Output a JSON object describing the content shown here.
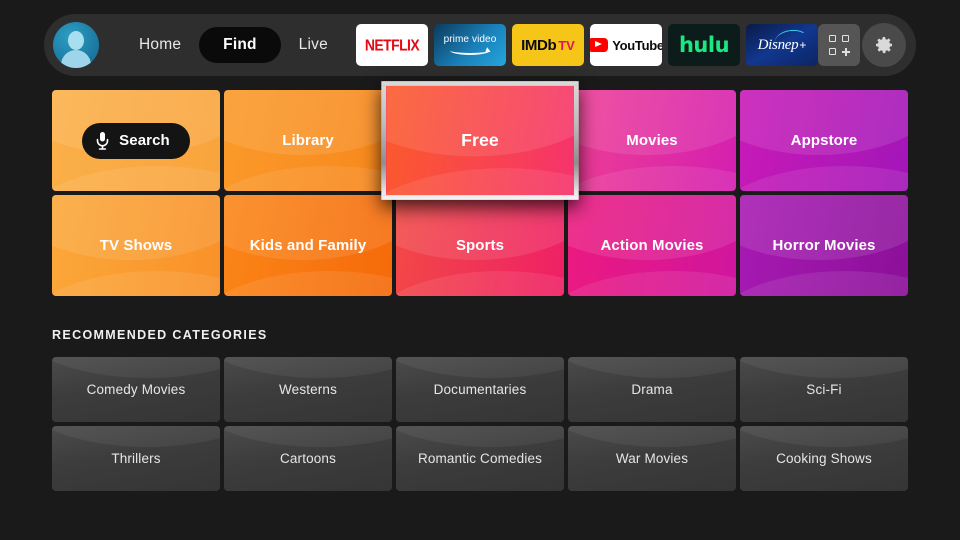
{
  "nav": {
    "avatar_label": "Profile",
    "tabs": [
      {
        "label": "Home",
        "active": false
      },
      {
        "label": "Find",
        "active": true
      },
      {
        "label": "Live",
        "active": false
      }
    ],
    "apps": [
      {
        "name": "NETFLIX",
        "id": "netflix"
      },
      {
        "name": "prime video",
        "id": "prime-video"
      },
      {
        "name": "IMDb TV",
        "id": "imdb-tv",
        "part1": "IMDb",
        "part2": "TV"
      },
      {
        "name": "YouTube",
        "id": "youtube"
      },
      {
        "name": "hulu",
        "id": "hulu"
      },
      {
        "name": "Disney+",
        "id": "disney-plus",
        "part1": "Disnep",
        "part2": "+"
      }
    ],
    "apps_button_label": "Apps",
    "settings_button_label": "Settings"
  },
  "main_grid": {
    "tiles": [
      {
        "label": "Search",
        "id": "search",
        "is_search": true,
        "color_start": "#fbb04a",
        "color_end": "#f9a43c"
      },
      {
        "label": "Library",
        "id": "library",
        "color_start": "#fa9a2a",
        "color_end": "#f8871c"
      },
      {
        "label": "Free",
        "id": "free",
        "selected": true,
        "color_start": "#fb5b2a",
        "color_end": "#f6326d"
      },
      {
        "label": "Movies",
        "id": "movies",
        "color_start": "#ef3f94",
        "color_end": "#d41fb0"
      },
      {
        "label": "Appstore",
        "id": "appstore",
        "color_start": "#c81ab7",
        "color_end": "#a316b8"
      },
      {
        "label": "TV Shows",
        "id": "tv-shows",
        "color_start": "#fba83a",
        "color_end": "#f99128"
      },
      {
        "label": "Kids and Family",
        "id": "kids-and-family",
        "color_start": "#fb8618",
        "color_end": "#f56a0a"
      },
      {
        "label": "Sports",
        "id": "sports",
        "color_start": "#f24a45",
        "color_end": "#ef1f66"
      },
      {
        "label": "Action Movies",
        "id": "action-movies",
        "color_start": "#ec1a7e",
        "color_end": "#d0159f"
      },
      {
        "label": "Horror Movies",
        "id": "horror-movies",
        "color_start": "#a71ab2",
        "color_end": "#8b1099"
      }
    ]
  },
  "recommended": {
    "heading": "RECOMMENDED CATEGORIES",
    "tiles": [
      {
        "label": "Comedy Movies",
        "id": "comedy-movies"
      },
      {
        "label": "Westerns",
        "id": "westerns"
      },
      {
        "label": "Documentaries",
        "id": "documentaries"
      },
      {
        "label": "Drama",
        "id": "drama"
      },
      {
        "label": "Sci-Fi",
        "id": "sci-fi"
      },
      {
        "label": "Thrillers",
        "id": "thrillers"
      },
      {
        "label": "Cartoons",
        "id": "cartoons"
      },
      {
        "label": "Romantic Comedies",
        "id": "romantic-comedies"
      },
      {
        "label": "War Movies",
        "id": "war-movies"
      },
      {
        "label": "Cooking Shows",
        "id": "cooking-shows"
      }
    ]
  },
  "colors": {
    "background": "#1a1a1a",
    "navbar": "#2e2e2e",
    "active_tab": "#0a0a0a",
    "selection_border": "#d8d8d8"
  }
}
